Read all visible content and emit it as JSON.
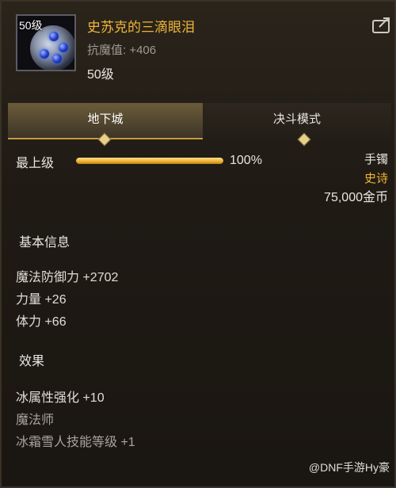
{
  "item": {
    "level_badge": "50级",
    "name": "史苏克的三滴眼泪",
    "resist": "抗魔值: +406",
    "level": "50级"
  },
  "tabs": [
    {
      "label": "地下城",
      "active": true
    },
    {
      "label": "决斗模式",
      "active": false
    }
  ],
  "progress": {
    "label": "最上级",
    "percent_text": "100%",
    "value": 1.0
  },
  "info": {
    "type": "手镯",
    "grade": "史诗",
    "price": "75,000金币"
  },
  "basic": {
    "title": "基本信息",
    "stats": [
      "魔法防御力 +2702",
      "力量 +26",
      "体力 +66"
    ]
  },
  "effects": {
    "title": "效果",
    "stats": [
      "冰属性强化 +10",
      "魔法师",
      "冰霜雪人技能等级 +1"
    ]
  },
  "watermark": "@DNF手游Hy豪",
  "colors": {
    "gold": "#f0b638",
    "text": "#e8e6e0",
    "dim": "#9e9a90"
  }
}
